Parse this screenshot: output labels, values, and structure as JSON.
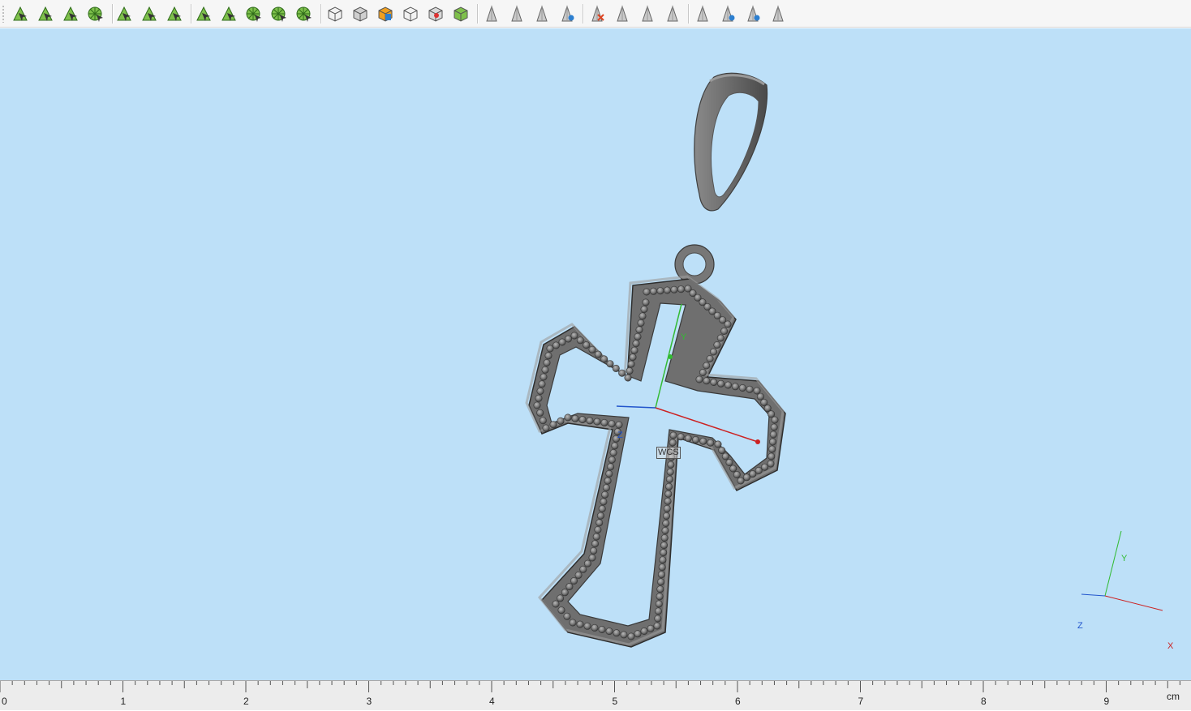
{
  "toolbar": {
    "groups": [
      [
        "select-arrow-icon",
        "select-surface-icon",
        "select-curve-icon",
        "select-solid-icon"
      ],
      [
        "rectangle-icon",
        "point-link-icon",
        "curve-tool-icon"
      ],
      [
        "mesh-edit-icon",
        "node-tool-icon",
        "star-pattern-icon",
        "wheel-pattern-icon",
        "gem-tool-icon"
      ],
      [
        "box-view-icon",
        "box-shaded-icon",
        "box-color-icon",
        "box-wire-icon",
        "box-gem-icon",
        "box-green-icon"
      ],
      [
        "pointer-gray-icon",
        "pointer-stripe-icon",
        "pointer-dual-icon",
        "pointer-analyze-icon"
      ],
      [
        "delete-pointer-icon",
        "hatch-pointer-icon",
        "copy-pointer-icon",
        "shade-pointer-icon"
      ],
      [
        "pointer-eye-icon",
        "pointer-layers-icon",
        "pointer-blue-icon",
        "pointer-frame-icon"
      ]
    ]
  },
  "viewport": {
    "background_color": "#bde0f8",
    "wcs_label": "WCS",
    "wcs_axis_labels": {
      "y": "Y",
      "z": "Z"
    },
    "triad_labels": {
      "x": "X",
      "y": "Y",
      "z": "Z"
    },
    "model_color": "#6f6f6f",
    "axis_colors": {
      "x": "#cc2222",
      "y": "#33bb33",
      "z": "#2255cc"
    }
  },
  "ruler": {
    "labels": [
      "0",
      "1",
      "2",
      "3",
      "4",
      "5",
      "6",
      "7",
      "8",
      "9"
    ],
    "unit": "cm"
  }
}
